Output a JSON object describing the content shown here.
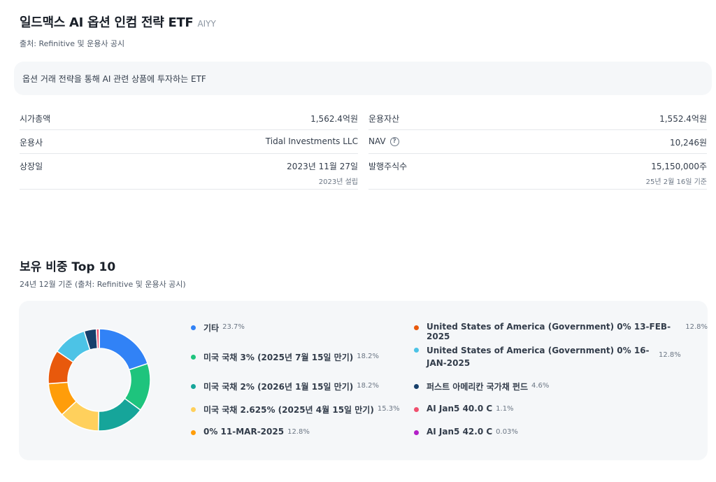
{
  "header": {
    "title": "일드맥스 AI 옵션 인컴 전략 ETF",
    "ticker": "AIYY",
    "source": "출처: Refinitive 및 운용사 공시"
  },
  "description": "옵션 거래 전략을 통해 AI 관련 상품에 투자하는 ETF",
  "info_left": [
    {
      "label": "시가총액",
      "value": "1,562.4억원"
    },
    {
      "label": "운용사",
      "value": "Tidal Investments LLC"
    },
    {
      "label": "상장일",
      "value": "2023년 11월 27일",
      "sub": "2023년 설립"
    }
  ],
  "info_right": [
    {
      "label": "운용자산",
      "value": "1,552.4억원"
    },
    {
      "label": "NAV",
      "value": "10,246원",
      "icon": "help-circle-icon"
    },
    {
      "label": "발행주식수",
      "value": "15,150,000주",
      "sub": "25년 2월 16일 기준"
    }
  ],
  "holdings": {
    "title": "보유 비중 Top 10",
    "subtitle": "24년 12월 기준 (출처: Refinitive 및 운용사 공시)",
    "items": [
      {
        "name": "기타",
        "pct": "23.7%",
        "value": 23.7,
        "color": "#3182f6"
      },
      {
        "name": "미국 국채 3% (2025년 7월 15일 만기)",
        "pct": "18.2%",
        "value": 18.2,
        "color": "#1ec47d"
      },
      {
        "name": "미국 국채 2% (2026년 1월 15일 만기)",
        "pct": "18.2%",
        "value": 18.2,
        "color": "#16a59a"
      },
      {
        "name": "미국 국채 2.625% (2025년 4월 15일 만기)",
        "pct": "15.3%",
        "value": 15.3,
        "color": "#ffd05c"
      },
      {
        "name": "0% 11-MAR-2025",
        "pct": "12.8%",
        "value": 12.8,
        "color": "#ff9d0a"
      },
      {
        "name": "United States of America (Government) 0% 13-FEB-2025",
        "pct": "12.8%",
        "value": 12.8,
        "color": "#e8590c"
      },
      {
        "name": "United States of America (Government) 0% 16-JAN-2025",
        "pct": "12.8%",
        "value": 12.8,
        "color": "#4cc3e6"
      },
      {
        "name": "퍼스트 아메리칸 국가채 펀드",
        "pct": "4.6%",
        "value": 4.6,
        "color": "#173f6b"
      },
      {
        "name": "AI Jan5 40.0 C",
        "pct": "1.1%",
        "value": 1.1,
        "color": "#f0506e"
      },
      {
        "name": "AI Jan5 42.0 C",
        "pct": "0.03%",
        "value": 0.03,
        "color": "#b320c8"
      }
    ]
  }
}
